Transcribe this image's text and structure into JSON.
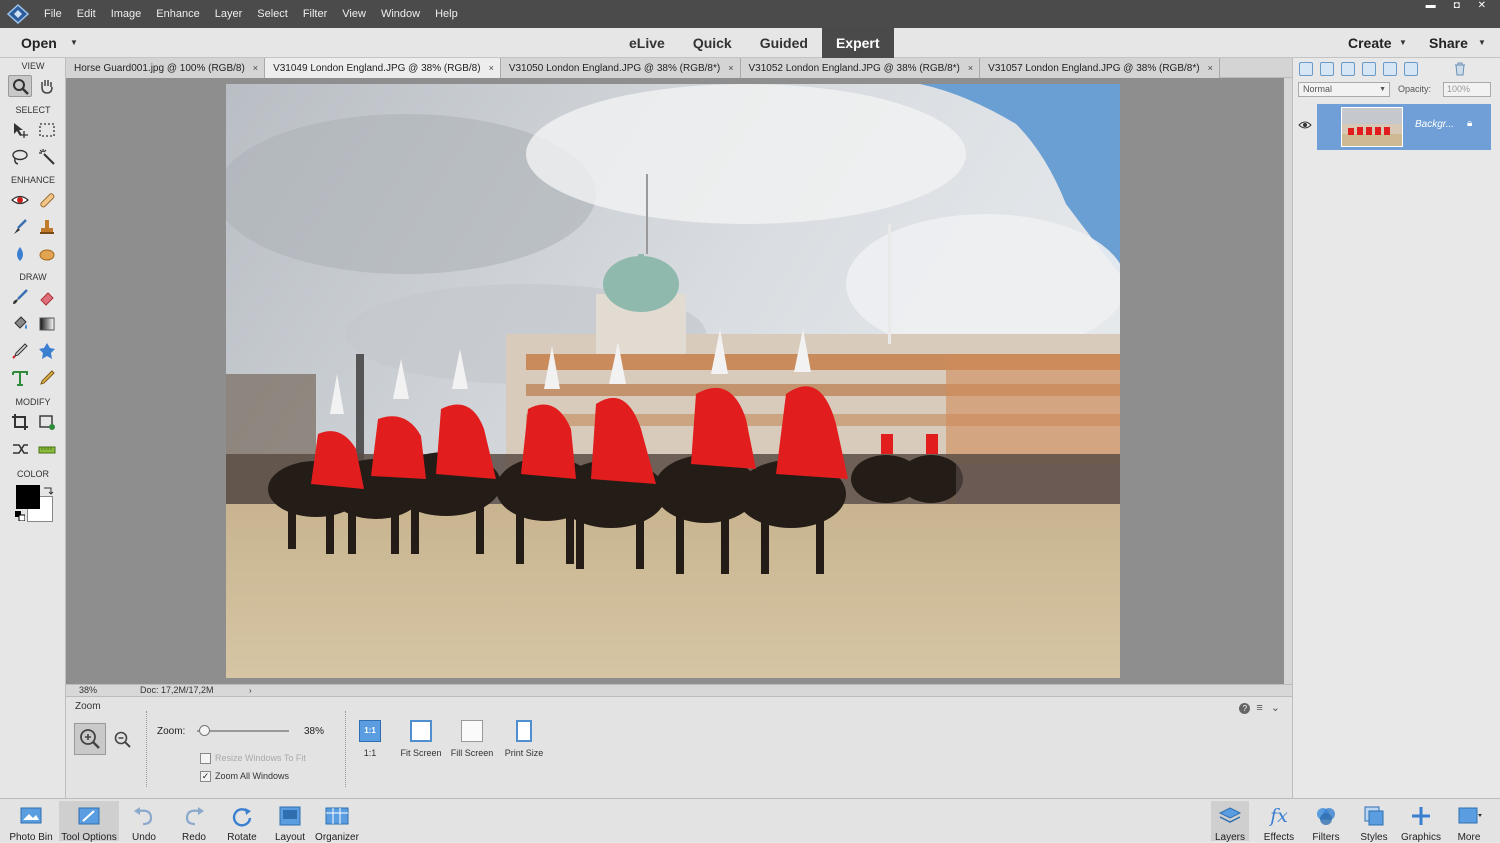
{
  "app": {
    "logo_icon": "elements-logo-icon"
  },
  "menu": [
    "File",
    "Edit",
    "Image",
    "Enhance",
    "Layer",
    "Select",
    "Filter",
    "View",
    "Window",
    "Help"
  ],
  "window_controls": {
    "minimize": "▬",
    "maximize": "◘",
    "close": "✕"
  },
  "modebar": {
    "open": "Open",
    "modes": [
      "eLive",
      "Quick",
      "Guided",
      "Expert"
    ],
    "active_mode": "Expert",
    "create": "Create",
    "share": "Share"
  },
  "toolbox": {
    "sections": {
      "view": "VIEW",
      "select": "SELECT",
      "enhance": "ENHANCE",
      "draw": "DRAW",
      "modify": "MODIFY",
      "color": "COLOR"
    },
    "tools": [
      "zoom-tool-icon",
      "hand-tool-icon",
      "move-tool-icon",
      "marquee-tool-icon",
      "lasso-tool-icon",
      "magic-wand-icon",
      "red-eye-icon",
      "spot-healing-icon",
      "smart-brush-icon",
      "clone-stamp-icon",
      "blur-icon",
      "sponge-icon",
      "brush-icon",
      "eraser-icon",
      "paint-bucket-icon",
      "gradient-icon",
      "eyedropper-icon",
      "custom-shape-icon",
      "type-tool-icon",
      "pencil-icon",
      "crop-tool-icon",
      "recompose-icon",
      "content-aware-move-icon",
      "straighten-icon"
    ],
    "foreground_color": "#000000",
    "background_color": "#ffffff"
  },
  "document_tabs": [
    {
      "title": "Horse Guard001.jpg @ 100% (RGB/8)",
      "close": "×",
      "active": false
    },
    {
      "title": "V31049 London England.JPG @ 38% (RGB/8)",
      "close": "×",
      "active": true
    },
    {
      "title": "V31050 London England.JPG @ 38% (RGB/8*)",
      "close": "×",
      "active": false
    },
    {
      "title": "V31052 London England.JPG @ 38% (RGB/8*)",
      "close": "×",
      "active": false
    },
    {
      "title": "V31057 London England.JPG @ 38% (RGB/8*)",
      "close": "×",
      "active": false
    }
  ],
  "status": {
    "zoom": "38%",
    "doc": "Doc: 17,2M/17,2M"
  },
  "tool_options": {
    "title": "Zoom",
    "zoom_label": "Zoom:",
    "zoom_value": "38%",
    "zoom_level": 0.38,
    "resize_windows": "Resize Windows To Fit",
    "zoom_all_windows": "Zoom All Windows",
    "zoom_all_checked": "✓",
    "view_buttons": [
      "1:1",
      "Fit Screen",
      "Fill Screen",
      "Print Size"
    ],
    "one_to_one_badge": "1:1",
    "help": "?",
    "menu": "≡",
    "collapse": "⌄"
  },
  "layers_panel": {
    "blend_mode": "Normal",
    "opacity_label": "Opacity:",
    "opacity_value": "100%",
    "layer_name": "Backgr...",
    "layer_visible": true
  },
  "bottom_bar": {
    "left": [
      "Photo Bin",
      "Tool Options",
      "Undo",
      "Redo",
      "Rotate",
      "Layout",
      "Organizer"
    ],
    "right": [
      "Layers",
      "Effects",
      "Filters",
      "Styles",
      "Graphics",
      "More"
    ],
    "selected_left": "Tool Options",
    "selected_right": "Layers"
  }
}
